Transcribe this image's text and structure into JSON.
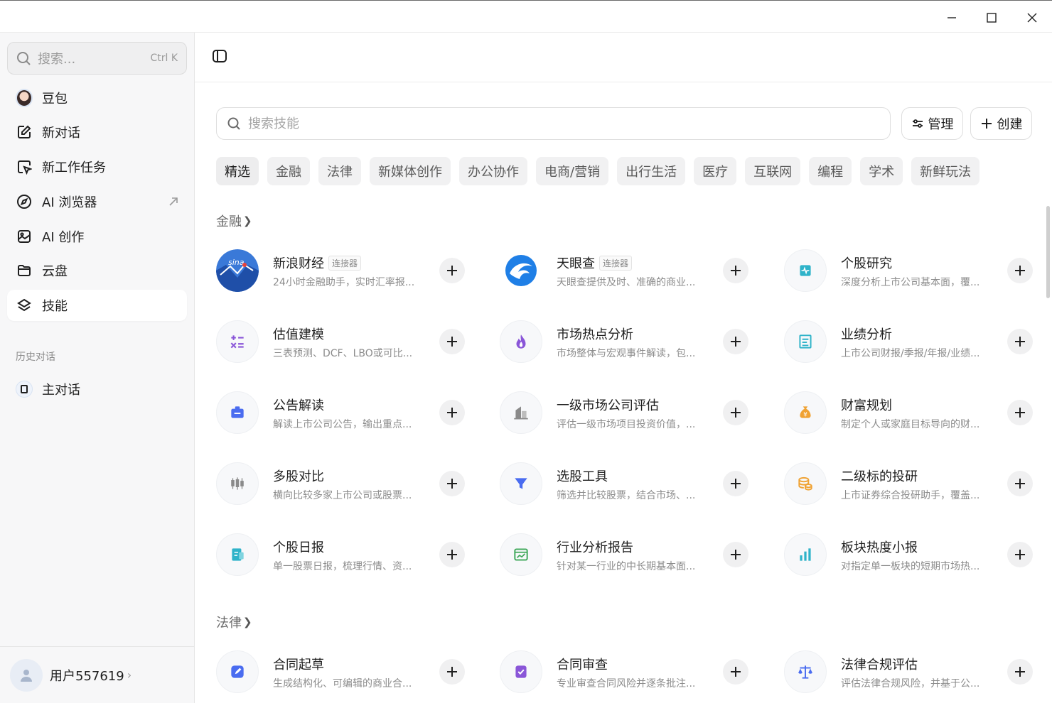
{
  "sidebar": {
    "search": {
      "placeholder": "搜索...",
      "shortcut": "Ctrl K"
    },
    "items": [
      {
        "label": "豆包",
        "icon": "avatar"
      },
      {
        "label": "新对话",
        "icon": "edit-icon"
      },
      {
        "label": "新工作任务",
        "icon": "task-icon"
      },
      {
        "label": "AI 浏览器",
        "icon": "compass-icon"
      },
      {
        "label": "AI 创作",
        "icon": "image-icon"
      },
      {
        "label": "云盘",
        "icon": "folder-icon"
      },
      {
        "label": "技能",
        "icon": "layers-icon"
      }
    ],
    "history_label": "历史对话",
    "history": [
      {
        "label": "主对话"
      }
    ],
    "user": {
      "name": "用户557619"
    }
  },
  "main": {
    "search_placeholder": "搜索技能",
    "manage_label": "管理",
    "create_label": "创建",
    "tabs": [
      "精选",
      "金融",
      "法律",
      "新媒体创作",
      "办公协作",
      "电商/营销",
      "出行生活",
      "医疗",
      "互联网",
      "编程",
      "学术",
      "新鲜玩法"
    ],
    "categories": [
      {
        "title": "金融",
        "skills": [
          {
            "name": "新浪财经",
            "tag": "连接器",
            "desc": "24小时金融助手，实时汇率报...",
            "icon": "sina-logo",
            "color": "#e8413b"
          },
          {
            "name": "天眼查",
            "tag": "连接器",
            "desc": "天眼查提供及时、准确的商业...",
            "icon": "tianyancha-logo",
            "color": "#1f7fe6"
          },
          {
            "name": "个股研究",
            "desc": "深度分析上市公司基本面，覆...",
            "icon": "pulse-icon",
            "color": "#2fb3c9"
          },
          {
            "name": "估值建模",
            "desc": "三表预测、DCF、LBO或可比...",
            "icon": "calculator-icon",
            "color": "#8a56d8"
          },
          {
            "name": "市场热点分析",
            "desc": "市场整体与宏观事件解读，包...",
            "icon": "flame-icon",
            "color": "#8a56d8"
          },
          {
            "name": "业绩分析",
            "desc": "上市公司财报/季报/年报/业绩...",
            "icon": "report-icon",
            "color": "#2fb3c9"
          },
          {
            "name": "公告解读",
            "desc": "解读上市公司公告，输出重点...",
            "icon": "notice-icon",
            "color": "#4a6cf0"
          },
          {
            "name": "一级市场公司评估",
            "desc": "评估一级市场项目投资价值，...",
            "icon": "building-icon",
            "color": "#8a8a8a"
          },
          {
            "name": "财富规划",
            "desc": "制定个人或家庭目标导向的财...",
            "icon": "money-bag-icon",
            "color": "#f0a233"
          },
          {
            "name": "多股对比",
            "desc": "横向比较多家上市公司或股票...",
            "icon": "candles-icon",
            "color": "#8a8a8a"
          },
          {
            "name": "选股工具",
            "desc": "筛选并比较股票，结合市场、...",
            "icon": "filter-icon",
            "color": "#4a6cf0"
          },
          {
            "name": "二级标的投研",
            "desc": "上市证券综合投研助手，覆盖...",
            "icon": "coins-icon",
            "color": "#f0a233"
          },
          {
            "name": "个股日报",
            "desc": "单一股票日报，梳理行情、资...",
            "icon": "daily-icon",
            "color": "#2fb3c9"
          },
          {
            "name": "行业分析报告",
            "desc": "针对某一行业的中长期基本面...",
            "icon": "chart-board-icon",
            "color": "#3fa85a"
          },
          {
            "name": "板块热度小报",
            "desc": "对指定单一板块的短期市场热...",
            "icon": "bar-chart-icon",
            "color": "#2fb3c9"
          }
        ]
      },
      {
        "title": "法律",
        "skills": [
          {
            "name": "合同起草",
            "desc": "生成结构化、可编辑的商业合...",
            "icon": "draft-icon",
            "color": "#4a6cf0"
          },
          {
            "name": "合同审查",
            "desc": "专业审查合同风险并逐条批注...",
            "icon": "check-doc-icon",
            "color": "#8a56d8"
          },
          {
            "name": "法律合规评估",
            "desc": "评估法律合规风险，并基于公...",
            "icon": "scale-icon",
            "color": "#4a6cf0"
          }
        ]
      }
    ]
  }
}
